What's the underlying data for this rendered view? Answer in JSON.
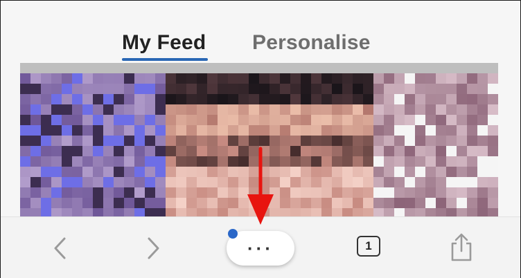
{
  "tabs": [
    {
      "label": "My Feed",
      "active": true
    },
    {
      "label": "Personalise",
      "active": false
    }
  ],
  "feed": {
    "image": "pixelated-face"
  },
  "toolbar": {
    "back_icon": "chevron-left-icon",
    "forward_icon": "chevron-right-icon",
    "more_label": "···",
    "tab_count": "1",
    "share_icon": "share-icon",
    "notification": true
  },
  "colors": {
    "accent": "#2a67b4",
    "notification_dot": "#2a67c8",
    "annotation_arrow": "#e8140f"
  }
}
